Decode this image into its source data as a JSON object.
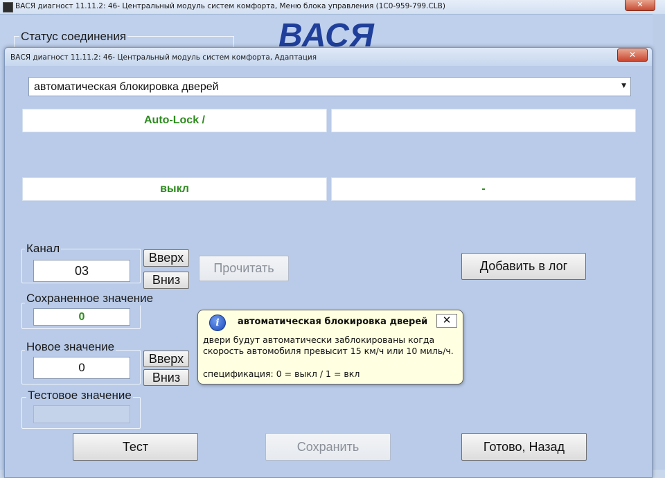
{
  "background_window": {
    "title": "ВАСЯ диагност 11.11.2: 46- Центральный модуль систем комфорта,  Меню блока управления (1C0-959-799.CLB)",
    "close_glyph": "✕",
    "status_label": "Статус соединения",
    "logo": "ВАСЯ"
  },
  "dialog": {
    "title": "ВАСЯ диагност 11.11.2: 46- Центральный модуль систем комфорта, Адаптация",
    "close_glyph": "✕",
    "function_select": {
      "value": "автоматическая блокировка дверей",
      "arrow_icon": "▼"
    },
    "readouts": {
      "top_left": "Auto-Lock /",
      "top_right": "",
      "bottom_left": "выкл",
      "bottom_right": "-"
    },
    "channel": {
      "label": "Канал",
      "value": "03",
      "up_label": "Вверх",
      "down_label": "Вниз"
    },
    "read_button": "Прочитать",
    "add_log_button": "Добавить в лог",
    "saved_value": {
      "label": "Сохраненное значение",
      "value": "0"
    },
    "new_value": {
      "label": "Новое значение",
      "value": "0",
      "up_label": "Вверх",
      "down_label": "Вниз"
    },
    "test_value": {
      "label": "Тестовое значение",
      "value": ""
    },
    "buttons": {
      "test": "Тест",
      "save": "Сохранить",
      "done": "Готово, Назад"
    }
  },
  "tooltip": {
    "icon": "i",
    "title": "автоматическая блокировка дверей",
    "close_glyph": "✕",
    "line1": "двери будут автоматически заблокированы когда",
    "line2": "скорость автомобиля превысит 15 км/ч или 10 миль/ч.",
    "line3": "спецификация: 0 = выкл / 1 = вкл"
  }
}
